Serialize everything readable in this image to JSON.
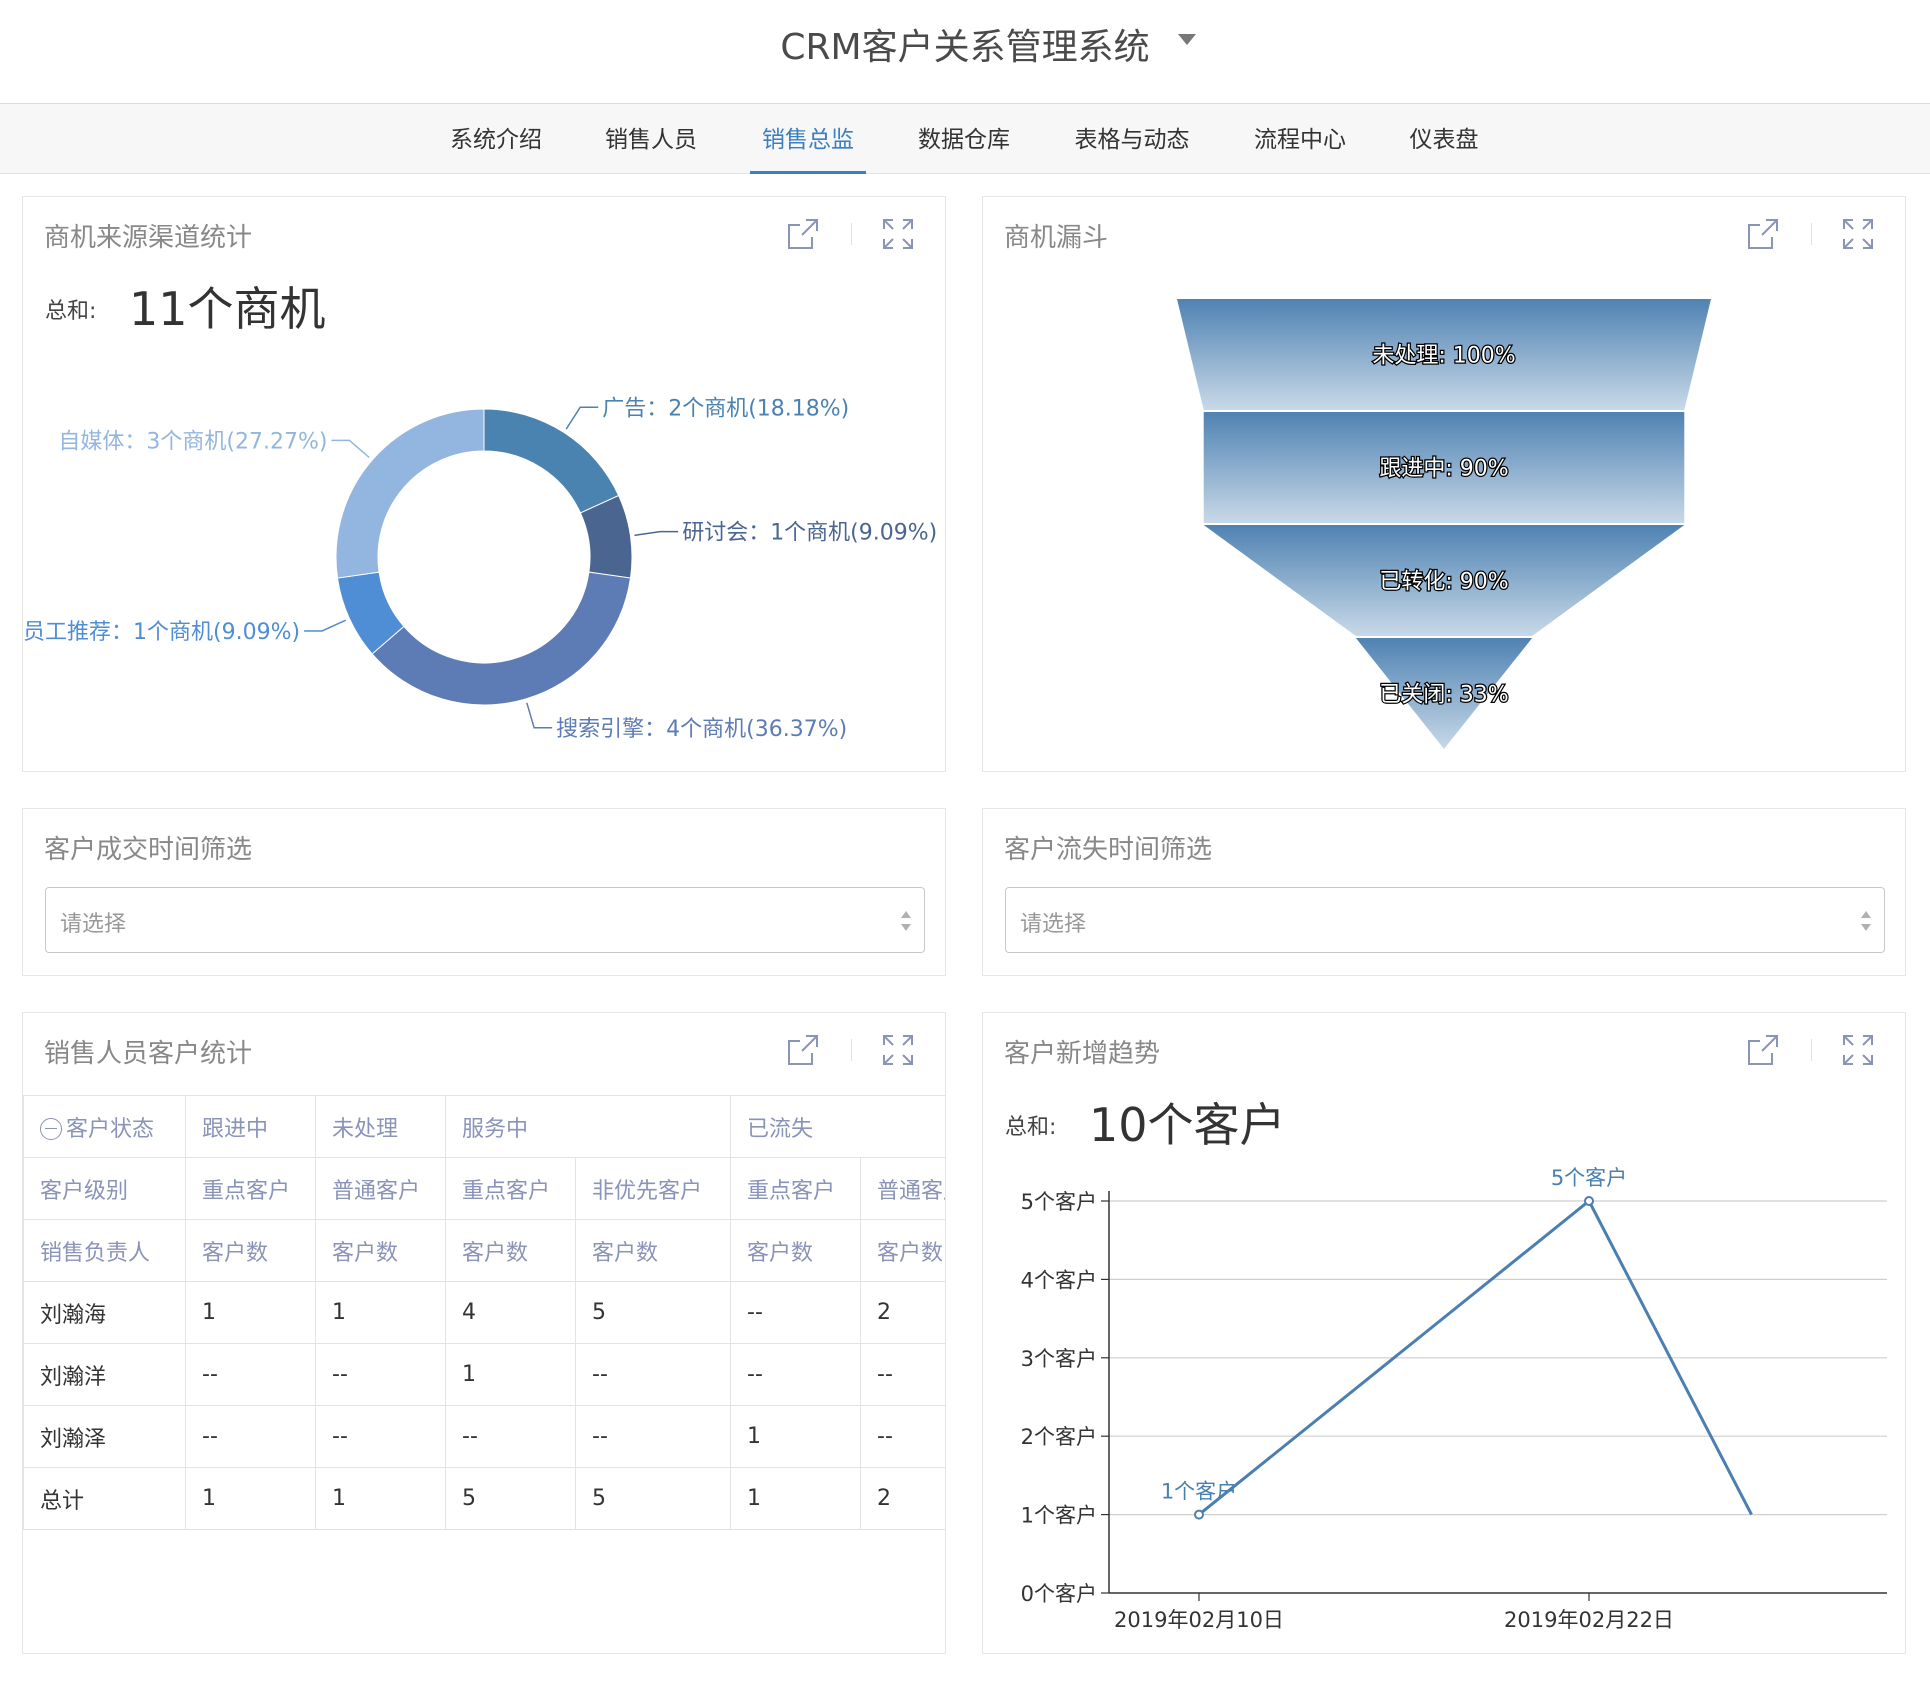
{
  "app": {
    "title": "CRM客户关系管理系统"
  },
  "nav": {
    "items": [
      {
        "label": "系统介绍"
      },
      {
        "label": "销售人员"
      },
      {
        "label": "销售总监"
      },
      {
        "label": "数据仓库"
      },
      {
        "label": "表格与动态"
      },
      {
        "label": "流程中心"
      },
      {
        "label": "仪表盘"
      }
    ],
    "active_index": 2
  },
  "colors": {
    "accent": "#3c7fc0",
    "panel_border": "#e6e6e6",
    "header_text": "#8a93b8",
    "line": "#4a7fb0"
  },
  "icons": {
    "open": "external-link-icon",
    "fullscreen": "fullscreen-icon",
    "collapse": "minus-circle-icon",
    "select": "updown-arrows-icon"
  },
  "source_panel": {
    "title": "商机来源渠道统计",
    "sum_label": "总和:",
    "sum_value": "11个商机"
  },
  "funnel_panel": {
    "title": "商机漏斗"
  },
  "deal_filter": {
    "title": "客户成交时间筛选",
    "placeholder": "请选择"
  },
  "lost_filter": {
    "title": "客户流失时间筛选",
    "placeholder": "请选择"
  },
  "sales_table": {
    "title": "销售人员客户统计",
    "status_row": [
      "客户状态",
      "跟进中",
      "未处理",
      "服务中",
      "已流失"
    ],
    "level_row": [
      "客户级别",
      "重点客户",
      "普通客户",
      "重点客户",
      "非优先客户",
      "重点客户",
      "普通客户"
    ],
    "owner_row": [
      "销售负责人",
      "客户数",
      "客户数",
      "客户数",
      "客户数",
      "客户数",
      "客户数"
    ],
    "rows": [
      {
        "name": "刘瀚海",
        "cells": [
          "1",
          "1",
          "4",
          "5",
          "--",
          "2"
        ]
      },
      {
        "name": "刘瀚洋",
        "cells": [
          "--",
          "--",
          "1",
          "--",
          "--",
          "--"
        ]
      },
      {
        "name": "刘瀚泽",
        "cells": [
          "--",
          "--",
          "--",
          "--",
          "1",
          "--"
        ]
      },
      {
        "name": "总计",
        "cells": [
          "1",
          "1",
          "5",
          "5",
          "1",
          "2"
        ]
      }
    ]
  },
  "trend_panel": {
    "title": "客户新增趋势",
    "sum_label": "总和:",
    "sum_value": "10个客户"
  },
  "chart_data": [
    {
      "type": "pie",
      "subtype": "donut",
      "slices": [
        {
          "label": "广告",
          "value": 2,
          "percent": "18.18%",
          "text": "广告：2个商机(18.18%)",
          "color": "#4a82b0"
        },
        {
          "label": "研讨会",
          "value": 1,
          "percent": "9.09%",
          "text": "研讨会：1个商机(9.09%)",
          "color": "#4b6591"
        },
        {
          "label": "搜索引擎",
          "value": 4,
          "percent": "36.37%",
          "text": "搜索引擎：4个商机(36.37%)",
          "color": "#5d7bb5"
        },
        {
          "label": "员工推荐",
          "value": 1,
          "percent": "9.09%",
          "text": "员工推荐：1个商机(9.09%)",
          "color": "#4f8dd4"
        },
        {
          "label": "自媒体",
          "value": 3,
          "percent": "27.27%",
          "text": "自媒体：3个商机(27.27%)",
          "color": "#93b6e0"
        }
      ]
    },
    {
      "type": "funnel",
      "stages": [
        {
          "label": "未处理",
          "value": 100,
          "text": "未处理: 100%"
        },
        {
          "label": "跟进中",
          "value": 90,
          "text": "跟进中: 90%"
        },
        {
          "label": "已转化",
          "value": 90,
          "text": "已转化: 90%"
        },
        {
          "label": "已关闭",
          "value": 33,
          "text": "已关闭: 33%"
        }
      ]
    },
    {
      "type": "line",
      "x": [
        "2019-02-10",
        "2019-02-22",
        "2019-02-27"
      ],
      "y": [
        1,
        5,
        1
      ],
      "x_tick_labels": [
        "2019年02月10日",
        "2019年02月22日"
      ],
      "y_tick_labels": [
        "0个客户",
        "1个客户",
        "2个客户",
        "3个客户",
        "4个客户",
        "5个客户"
      ],
      "ylim": [
        0,
        5
      ],
      "point_labels": [
        {
          "index": 0,
          "text": "1个客户"
        },
        {
          "index": 1,
          "text": "5个客户"
        }
      ],
      "grid": true
    }
  ]
}
